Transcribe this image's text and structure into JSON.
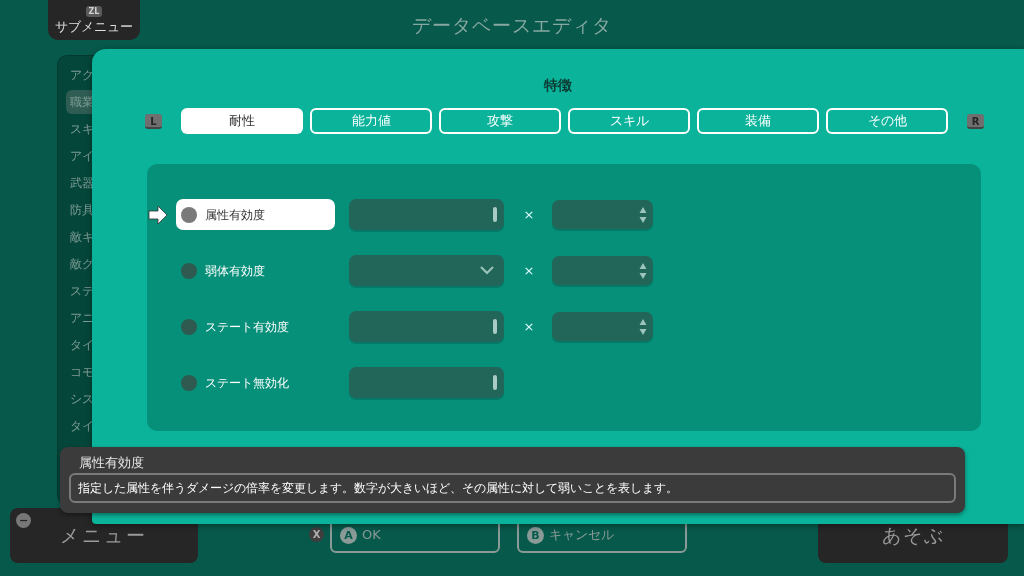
{
  "header": {
    "title": "データベースエディタ",
    "submenu": {
      "key": "ZL",
      "label": "サブメニュー"
    }
  },
  "sidebar": {
    "items": [
      {
        "label": "アク",
        "selected": false
      },
      {
        "label": "職業",
        "selected": true
      },
      {
        "label": "スキ",
        "selected": false
      },
      {
        "label": "アイ",
        "selected": false
      },
      {
        "label": "武器",
        "selected": false
      },
      {
        "label": "防具",
        "selected": false
      },
      {
        "label": "敵キ",
        "selected": false
      },
      {
        "label": "敵グ",
        "selected": false
      },
      {
        "label": "ステ",
        "selected": false
      },
      {
        "label": "アニ",
        "selected": false
      },
      {
        "label": "タイ",
        "selected": false
      },
      {
        "label": "コモ",
        "selected": false
      },
      {
        "label": "シス",
        "selected": false
      },
      {
        "label": "タイ",
        "selected": false
      }
    ]
  },
  "dialog": {
    "title": "特徴",
    "prev_key": "L",
    "next_key": "R",
    "tabs": [
      {
        "label": "耐性",
        "selected": true
      },
      {
        "label": "能力値",
        "selected": false
      },
      {
        "label": "攻撃",
        "selected": false
      },
      {
        "label": "スキル",
        "selected": false
      },
      {
        "label": "装備",
        "selected": false
      },
      {
        "label": "その他",
        "selected": false
      }
    ],
    "rows": [
      {
        "label": "属性有効度",
        "selected": true,
        "kind": "text",
        "multiplier": "×"
      },
      {
        "label": "弱体有効度",
        "selected": false,
        "kind": "dropdown",
        "multiplier": "×"
      },
      {
        "label": "ステート有効度",
        "selected": false,
        "kind": "text",
        "multiplier": "×"
      },
      {
        "label": "ステート無効化",
        "selected": false,
        "kind": "text"
      }
    ]
  },
  "help": {
    "title": "属性有効度",
    "text": "指定した属性を伴うダメージの倍率を変更します。数字が大きいほど、その属性に対して弱いことを表します。"
  },
  "bottom": {
    "menu": {
      "key": "−",
      "label": "メニュー"
    },
    "extra_key": "X",
    "ok": {
      "key": "A",
      "label": "OK"
    },
    "cancel": {
      "key": "B",
      "label": "キャンセル"
    },
    "play": {
      "label": "あそぶ"
    }
  }
}
